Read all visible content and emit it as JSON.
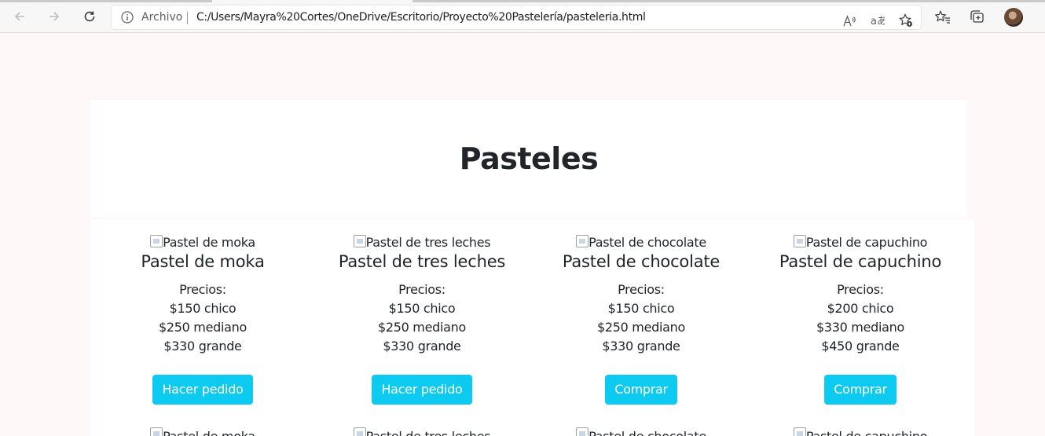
{
  "browser": {
    "scheme_label": "Archivo",
    "url": "C:/Users/Mayra%20Cortes/OneDrive/Escritorio/Proyecto%20Pastelería/pasteleria.html"
  },
  "page": {
    "title": "Pasteles",
    "colors": {
      "button": "#0dcaf0",
      "background": "#fdf8f7"
    },
    "products": [
      {
        "img_alt": "Pastel de moka",
        "name": "Pastel de moka",
        "prices_label": "Precios:",
        "price_small": "$150 chico",
        "price_medium": "$250 mediano",
        "price_large": "$330 grande",
        "button": "Hacer pedido"
      },
      {
        "img_alt": "Pastel de tres leches",
        "name": "Pastel de tres leches",
        "prices_label": "Precios:",
        "price_small": "$150 chico",
        "price_medium": "$250 mediano",
        "price_large": "$330 grande",
        "button": "Hacer pedido"
      },
      {
        "img_alt": "Pastel de chocolate",
        "name": "Pastel de chocolate",
        "prices_label": "Precios:",
        "price_small": "$150 chico",
        "price_medium": "$250 mediano",
        "price_large": "$330 grande",
        "button": "Comprar"
      },
      {
        "img_alt": "Pastel de capuchino",
        "name": "Pastel de capuchino",
        "prices_label": "Precios:",
        "price_small": "$200 chico",
        "price_medium": "$330 mediano",
        "price_large": "$450 grande",
        "button": "Comprar"
      }
    ]
  }
}
